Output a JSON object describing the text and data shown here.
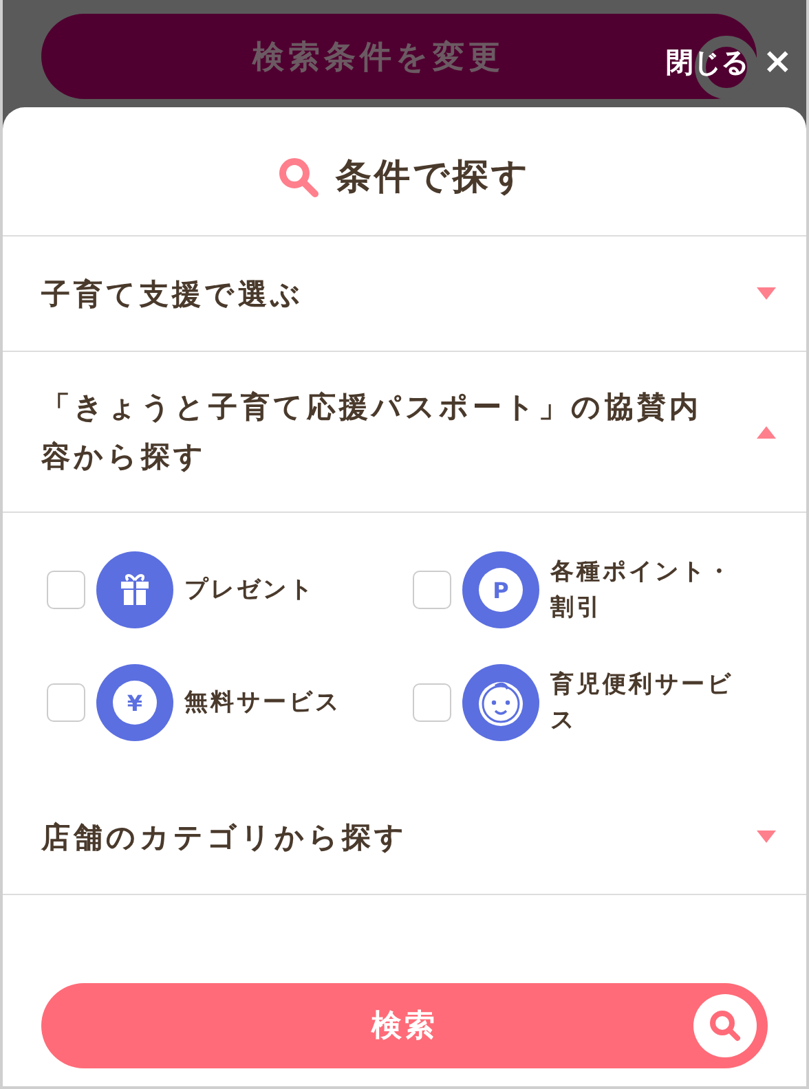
{
  "top_button": {
    "label": "検索条件を変更"
  },
  "close": {
    "label": "閉じる",
    "icon": "×"
  },
  "panel": {
    "title": "条件で探す"
  },
  "sections": [
    {
      "title": "子育て支援で選ぶ",
      "expanded": false
    },
    {
      "title": "「きょうと子育て応援パスポート」の協賛内容から探す",
      "expanded": true,
      "options": [
        {
          "label": "プレゼント",
          "kind": "gift",
          "checked": false
        },
        {
          "label": "各種ポイント・割引",
          "kind": "glyph",
          "glyph": "P",
          "checked": false
        },
        {
          "label": "無料サービス",
          "kind": "glyph",
          "glyph": "¥",
          "checked": false
        },
        {
          "label": "育児便利サービス",
          "kind": "baby",
          "checked": false
        }
      ]
    },
    {
      "title": "店舗のカテゴリから探す",
      "expanded": false
    }
  ],
  "search_button": {
    "label": "検索"
  }
}
